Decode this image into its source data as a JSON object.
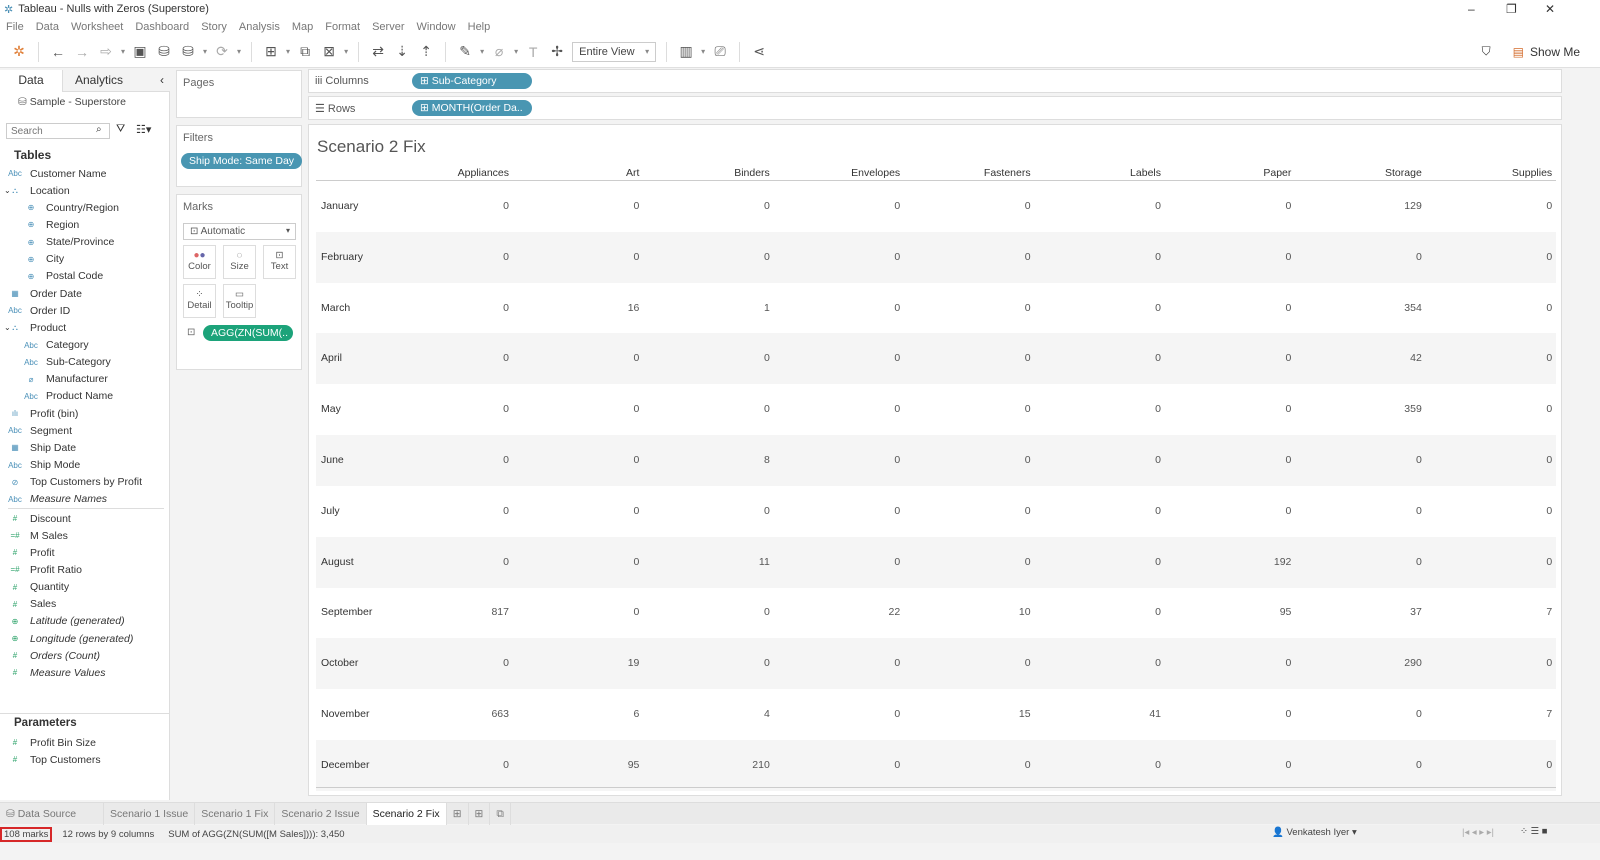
{
  "window": {
    "title": "Tableau - Nulls with Zeros (Superstore)"
  },
  "menu": [
    "File",
    "Data",
    "Worksheet",
    "Dashboard",
    "Story",
    "Analysis",
    "Map",
    "Format",
    "Server",
    "Window",
    "Help"
  ],
  "toolbar": {
    "fit": "Entire View",
    "show_me": "Show Me"
  },
  "left": {
    "tab_data": "Data",
    "tab_analytics": "Analytics",
    "datasource": "Sample - Superstore",
    "search_placeholder": "Search",
    "tables_label": "Tables",
    "parameters_label": "Parameters",
    "fields": [
      {
        "name": "Customer Name",
        "icon": "Abc",
        "indent": 0,
        "kind": "d"
      },
      {
        "name": "Location",
        "icon": "hier",
        "indent": 0,
        "kind": "d",
        "expand": true
      },
      {
        "name": "Country/Region",
        "icon": "globe",
        "indent": 1,
        "kind": "d"
      },
      {
        "name": "Region",
        "icon": "globe",
        "indent": 1,
        "kind": "d"
      },
      {
        "name": "State/Province",
        "icon": "globe",
        "indent": 1,
        "kind": "d"
      },
      {
        "name": "City",
        "icon": "globe",
        "indent": 1,
        "kind": "d"
      },
      {
        "name": "Postal Code",
        "icon": "globe",
        "indent": 1,
        "kind": "d"
      },
      {
        "name": "Order Date",
        "icon": "cal",
        "indent": 0,
        "kind": "d"
      },
      {
        "name": "Order ID",
        "icon": "Abc",
        "indent": 0,
        "kind": "d"
      },
      {
        "name": "Product",
        "icon": "hier",
        "indent": 0,
        "kind": "d",
        "expand": true
      },
      {
        "name": "Category",
        "icon": "Abc",
        "indent": 1,
        "kind": "d"
      },
      {
        "name": "Sub-Category",
        "icon": "Abc",
        "indent": 1,
        "kind": "d"
      },
      {
        "name": "Manufacturer",
        "icon": "clip",
        "indent": 1,
        "kind": "d"
      },
      {
        "name": "Product Name",
        "icon": "Abc",
        "indent": 1,
        "kind": "d"
      },
      {
        "name": "Profit (bin)",
        "icon": "bin",
        "indent": 0,
        "kind": "d"
      },
      {
        "name": "Segment",
        "icon": "Abc",
        "indent": 0,
        "kind": "d"
      },
      {
        "name": "Ship Date",
        "icon": "cal",
        "indent": 0,
        "kind": "d"
      },
      {
        "name": "Ship Mode",
        "icon": "Abc",
        "indent": 0,
        "kind": "d"
      },
      {
        "name": "Top Customers by Profit",
        "icon": "set",
        "indent": 0,
        "kind": "d"
      },
      {
        "name": "Measure Names",
        "icon": "Abc",
        "indent": 0,
        "kind": "d",
        "italic": true
      },
      {
        "name": "Discount",
        "icon": "#",
        "indent": 0,
        "kind": "m"
      },
      {
        "name": "M Sales",
        "icon": "=#",
        "indent": 0,
        "kind": "m"
      },
      {
        "name": "Profit",
        "icon": "#",
        "indent": 0,
        "kind": "m"
      },
      {
        "name": "Profit Ratio",
        "icon": "=#",
        "indent": 0,
        "kind": "m"
      },
      {
        "name": "Quantity",
        "icon": "#",
        "indent": 0,
        "kind": "m"
      },
      {
        "name": "Sales",
        "icon": "#",
        "indent": 0,
        "kind": "m"
      },
      {
        "name": "Latitude (generated)",
        "icon": "globe",
        "indent": 0,
        "kind": "m",
        "italic": true
      },
      {
        "name": "Longitude (generated)",
        "icon": "globe",
        "indent": 0,
        "kind": "m",
        "italic": true
      },
      {
        "name": "Orders (Count)",
        "icon": "#",
        "indent": 0,
        "kind": "m",
        "italic": true
      },
      {
        "name": "Measure Values",
        "icon": "#",
        "indent": 0,
        "kind": "m",
        "italic": true
      }
    ],
    "parameters": [
      "Profit Bin Size",
      "Top Customers"
    ]
  },
  "cards": {
    "pages": "Pages",
    "filters": "Filters",
    "filter_pill": "Ship Mode: Same Day",
    "marks": "Marks",
    "mark_type": "Automatic",
    "color": "Color",
    "size": "Size",
    "text": "Text",
    "detail": "Detail",
    "tooltip": "Tooltip",
    "text_pill": "AGG(ZN(SUM(.."
  },
  "shelves": {
    "columns": "Columns",
    "columns_pill": "Sub-Category",
    "rows": "Rows",
    "rows_pill": "MONTH(Order Da.."
  },
  "view": {
    "title": "Scenario 2 Fix",
    "columns": [
      "Appliances",
      "Art",
      "Binders",
      "Envelopes",
      "Fasteners",
      "Labels",
      "Paper",
      "Storage",
      "Supplies"
    ],
    "rows": [
      {
        "month": "January",
        "values": [
          0,
          0,
          0,
          0,
          0,
          0,
          0,
          129,
          0
        ]
      },
      {
        "month": "February",
        "values": [
          0,
          0,
          0,
          0,
          0,
          0,
          0,
          0,
          0
        ]
      },
      {
        "month": "March",
        "values": [
          0,
          16,
          1,
          0,
          0,
          0,
          0,
          354,
          0
        ]
      },
      {
        "month": "April",
        "values": [
          0,
          0,
          0,
          0,
          0,
          0,
          0,
          42,
          0
        ]
      },
      {
        "month": "May",
        "values": [
          0,
          0,
          0,
          0,
          0,
          0,
          0,
          359,
          0
        ]
      },
      {
        "month": "June",
        "values": [
          0,
          0,
          8,
          0,
          0,
          0,
          0,
          0,
          0
        ]
      },
      {
        "month": "July",
        "values": [
          0,
          0,
          0,
          0,
          0,
          0,
          0,
          0,
          0
        ]
      },
      {
        "month": "August",
        "values": [
          0,
          0,
          11,
          0,
          0,
          0,
          192,
          0,
          0
        ]
      },
      {
        "month": "September",
        "values": [
          817,
          0,
          0,
          22,
          10,
          0,
          95,
          37,
          7
        ]
      },
      {
        "month": "October",
        "values": [
          0,
          19,
          0,
          0,
          0,
          0,
          0,
          290,
          0
        ]
      },
      {
        "month": "November",
        "values": [
          663,
          6,
          4,
          0,
          15,
          41,
          0,
          0,
          7
        ]
      },
      {
        "month": "December",
        "values": [
          0,
          95,
          210,
          0,
          0,
          0,
          0,
          0,
          0
        ]
      }
    ]
  },
  "tabs": {
    "data_source": "Data Source",
    "sheets": [
      "Scenario 1 Issue",
      "Scenario 1 Fix",
      "Scenario 2 Issue",
      "Scenario 2 Fix"
    ],
    "active": 3
  },
  "status": {
    "marks": "108 marks",
    "dims": "12 rows by 9 columns",
    "sum": "SUM of AGG(ZN(SUM([M Sales]))): 3,450",
    "user": "Venkatesh Iyer"
  },
  "colors": {
    "pill_blue": "#4996b2",
    "pill_green": "#1ca37a",
    "highlight": "#d62728"
  }
}
